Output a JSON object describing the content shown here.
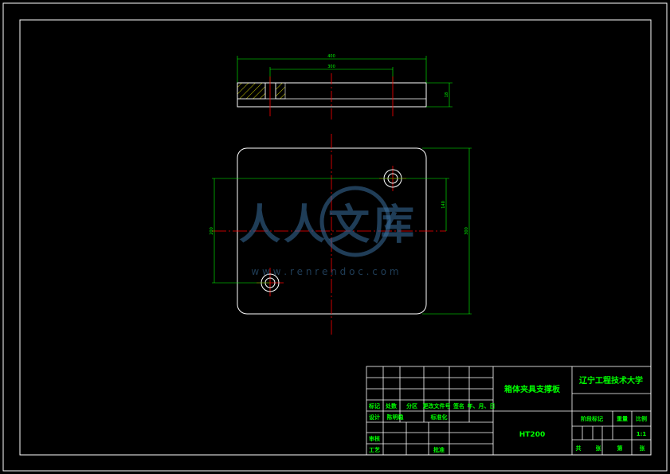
{
  "colors": {
    "background": "#000000",
    "frame": "#ffffff",
    "dimension": "#00ff00",
    "centerline": "#ff0000",
    "hatch": "#ffff00",
    "watermark": "#3a6f9e"
  },
  "dimensions": {
    "top_overall": "400",
    "top_holes": "300",
    "thickness": "18",
    "plan_height": "300",
    "plan_hole_v": "200",
    "plan_hole_h": "140"
  },
  "title_block": {
    "part_name": "箱体夹具支撑板",
    "school": "辽宁工程技术大学",
    "material": "HT200",
    "headers": {
      "mark": "标记",
      "count": "处数",
      "zone": "分区",
      "change_doc": "更改文件号",
      "signature": "签名",
      "date": "年、月、日"
    },
    "design": "设计",
    "designer": "陈明稳",
    "standardize": "标准化",
    "review": "审核",
    "process": "工艺",
    "approve": "批准",
    "stage_mark": "阶段标记",
    "weight": "重量",
    "scale_label": "比例",
    "scale_value": "1:1",
    "total_label": "共",
    "sheet_label": "张",
    "page_label": "第",
    "page_suffix": "张"
  },
  "watermark": {
    "text": "人人文库",
    "url": "w w w . r e n r e n d o c . c o m"
  }
}
